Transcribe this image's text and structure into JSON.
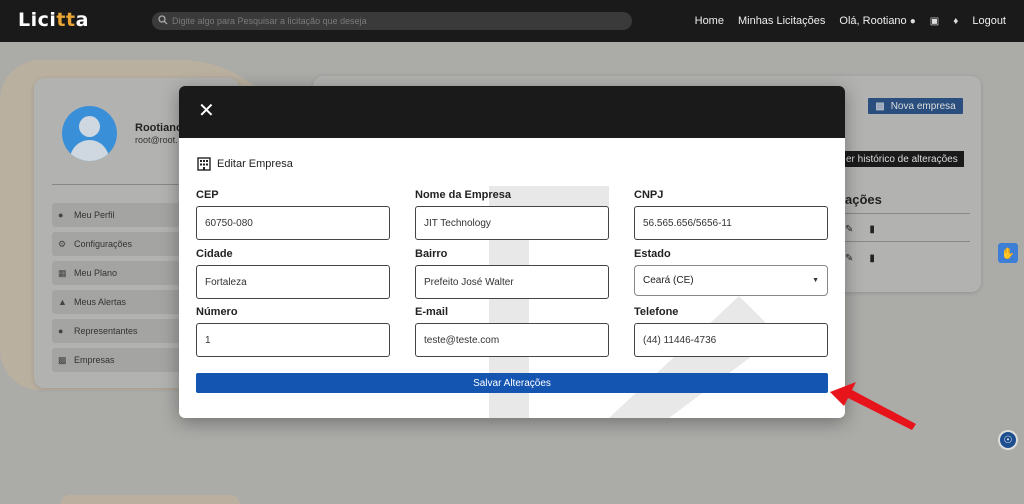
{
  "navbar": {
    "logo_prefix": "Lici",
    "logo_accent": "tt",
    "logo_suffix": "a",
    "search_placeholder": "Digite algo para Pesquisar a licitação que deseja",
    "links": [
      "Home",
      "Minhas Licitações",
      "Olá, Rootiano"
    ],
    "logout": "Logout"
  },
  "profile": {
    "name": "Rootiano",
    "email": "root@root.",
    "menu": [
      {
        "label": "Meu Perfil",
        "icon": "user-icon"
      },
      {
        "label": "Configurações",
        "icon": "gear-icon"
      },
      {
        "label": "Meu Plano",
        "icon": "map-icon"
      },
      {
        "label": "Meus Alertas",
        "icon": "warning-icon"
      },
      {
        "label": "Representantes",
        "icon": "users-icon"
      },
      {
        "label": "Empresas",
        "icon": "building-icon"
      }
    ]
  },
  "right_card": {
    "new_company": "Nova empresa",
    "history": "er histórico de alterações",
    "actions_heading": "ações"
  },
  "modal": {
    "title": "Editar Empresa",
    "fields": {
      "cep": {
        "label": "CEP",
        "value": "60750-080"
      },
      "nome": {
        "label": "Nome da Empresa",
        "value": "JIT Technology"
      },
      "cnpj": {
        "label": "CNPJ",
        "value": "56.565.656/5656-11"
      },
      "cidade": {
        "label": "Cidade",
        "value": "Fortaleza"
      },
      "bairro": {
        "label": "Bairro",
        "value": "Prefeito José Walter"
      },
      "estado": {
        "label": "Estado",
        "value": "Ceará (CE)"
      },
      "numero": {
        "label": "Número",
        "value": "1"
      },
      "email": {
        "label": "E-mail",
        "value": "teste@teste.com"
      },
      "telefone": {
        "label": "Telefone",
        "value": "(44) 11446-4736"
      }
    },
    "save_label": "Salvar Alterações"
  },
  "colors": {
    "accent": "#e8a534",
    "primary_button": "#1455b2",
    "annotation_arrow": "#e8141b"
  }
}
